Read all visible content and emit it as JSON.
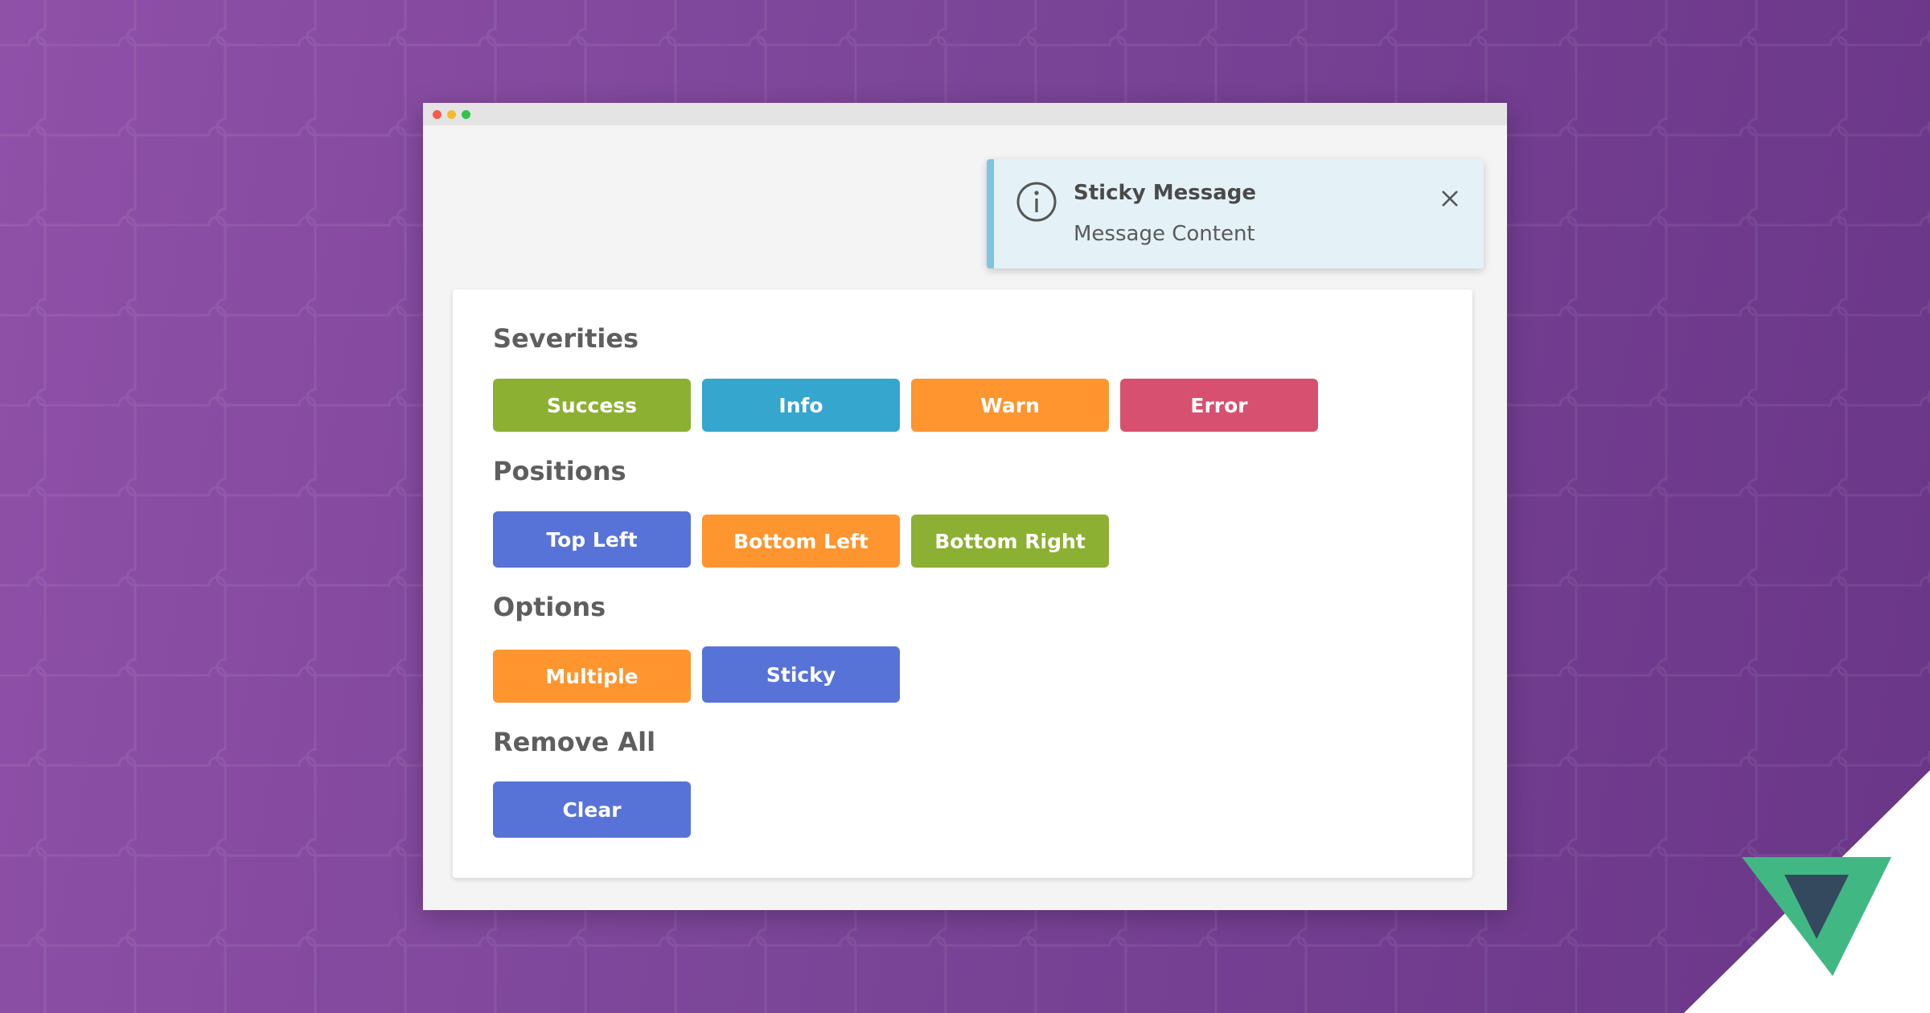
{
  "colors": {
    "success": "#8cb031",
    "info": "#35a6cd",
    "warn": "#fe952f",
    "error": "#d8506f",
    "primary": "#5873d8",
    "toast_accent": "#7fc4e2",
    "toast_bg": "#e4f1f7",
    "vue_green": "#41b883",
    "vue_dark": "#35495e"
  },
  "toast": {
    "icon": "info-circle-icon",
    "title": "Sticky Message",
    "content": "Message Content",
    "close_icon": "close-icon"
  },
  "sections": {
    "severities": {
      "title": "Severities",
      "buttons": {
        "success": "Success",
        "info": "Info",
        "warn": "Warn",
        "error": "Error"
      }
    },
    "positions": {
      "title": "Positions",
      "buttons": {
        "top_left": "Top Left",
        "bottom_left": "Bottom Left",
        "bottom_right": "Bottom Right"
      }
    },
    "options": {
      "title": "Options",
      "buttons": {
        "multiple": "Multiple",
        "sticky": "Sticky"
      }
    },
    "remove_all": {
      "title": "Remove All",
      "buttons": {
        "clear": "Clear"
      }
    }
  },
  "logo": "vue-logo"
}
